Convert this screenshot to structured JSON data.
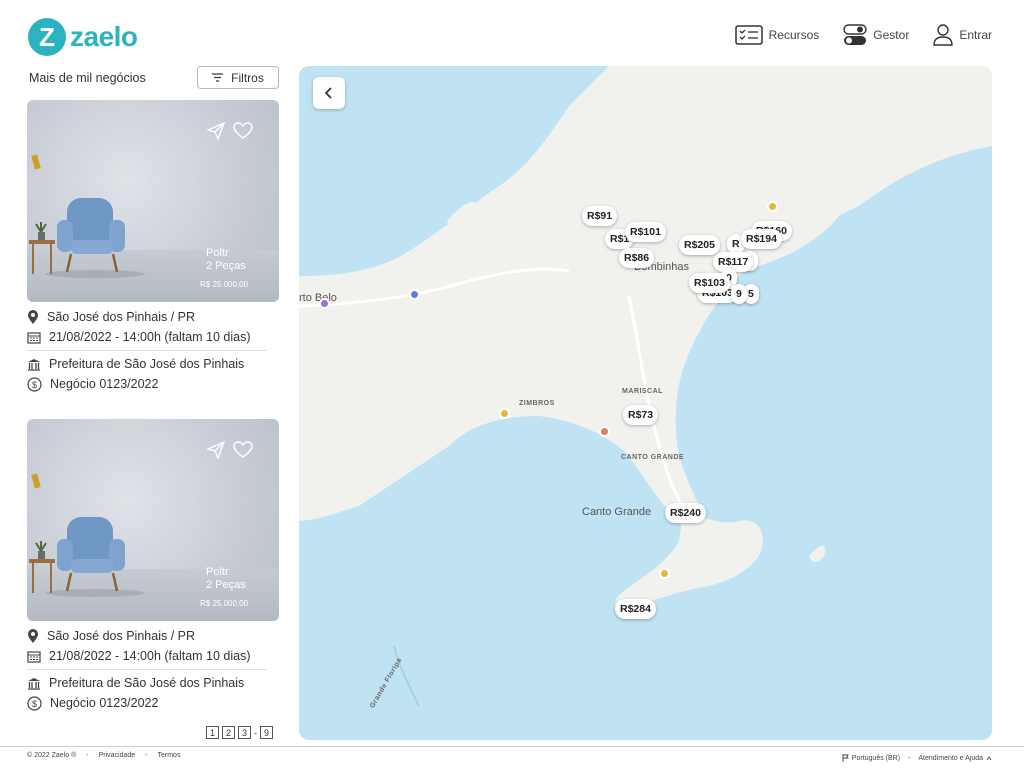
{
  "header": {
    "logo_mark": "Z",
    "logo_text": "zaelo",
    "nav": [
      {
        "label": "Recursos",
        "icon": "checklist-icon"
      },
      {
        "label": "Gestor",
        "icon": "toggle-icon"
      },
      {
        "label": "Entrar",
        "icon": "user-icon"
      }
    ]
  },
  "sidebar": {
    "title": "Mais de mil negócios",
    "filter_label": "Filtros",
    "cards": [
      {
        "image_label_1": "Poltr",
        "image_label_2": "2 Peças",
        "image_price": "R$ 25.000,00",
        "location": "São José dos Pinhais / PR",
        "date": "21/08/2022 - 14:00h (faltam 10 dias)",
        "org": "Prefeitura de São José dos Pinhais",
        "deal": "Negócio 0123/2022"
      },
      {
        "image_label_1": "Poltr",
        "image_label_2": "2 Peças",
        "image_price": "R$ 25.000,00",
        "location": "São José dos Pinhais / PR",
        "date": "21/08/2022 - 14:00h (faltam 10 dias)",
        "org": "Prefeitura de São José dos Pinhais",
        "deal": "Negócio 0123/2022"
      }
    ],
    "pagination": [
      "1",
      "2",
      "3",
      "-",
      "9"
    ]
  },
  "map": {
    "places": {
      "bombinhas": "Bombinhas",
      "porto_belo": "rto Belo",
      "canto_grande": "Canto Grande",
      "zimbros": "ZIMBROS",
      "mariscal": "MARISCAL",
      "canto_grande_small": "CANTO GRANDE",
      "road": "Grande Floripa"
    },
    "prices": [
      "R$91",
      "R$101",
      "R$1",
      "R$86",
      "R$205",
      "R$194",
      "R$117",
      "R$103",
      "R$103",
      "R$73",
      "R$240",
      "R$284",
      "R$160",
      "R",
      "5",
      "9",
      "0",
      "9"
    ]
  },
  "footer": {
    "copyright": "© 2022 Zaelo ®",
    "sep": "-",
    "privacy": "Privacidade",
    "terms": "Termos",
    "language": "Português (BR)",
    "help": "Atendimento e Ajuda"
  }
}
